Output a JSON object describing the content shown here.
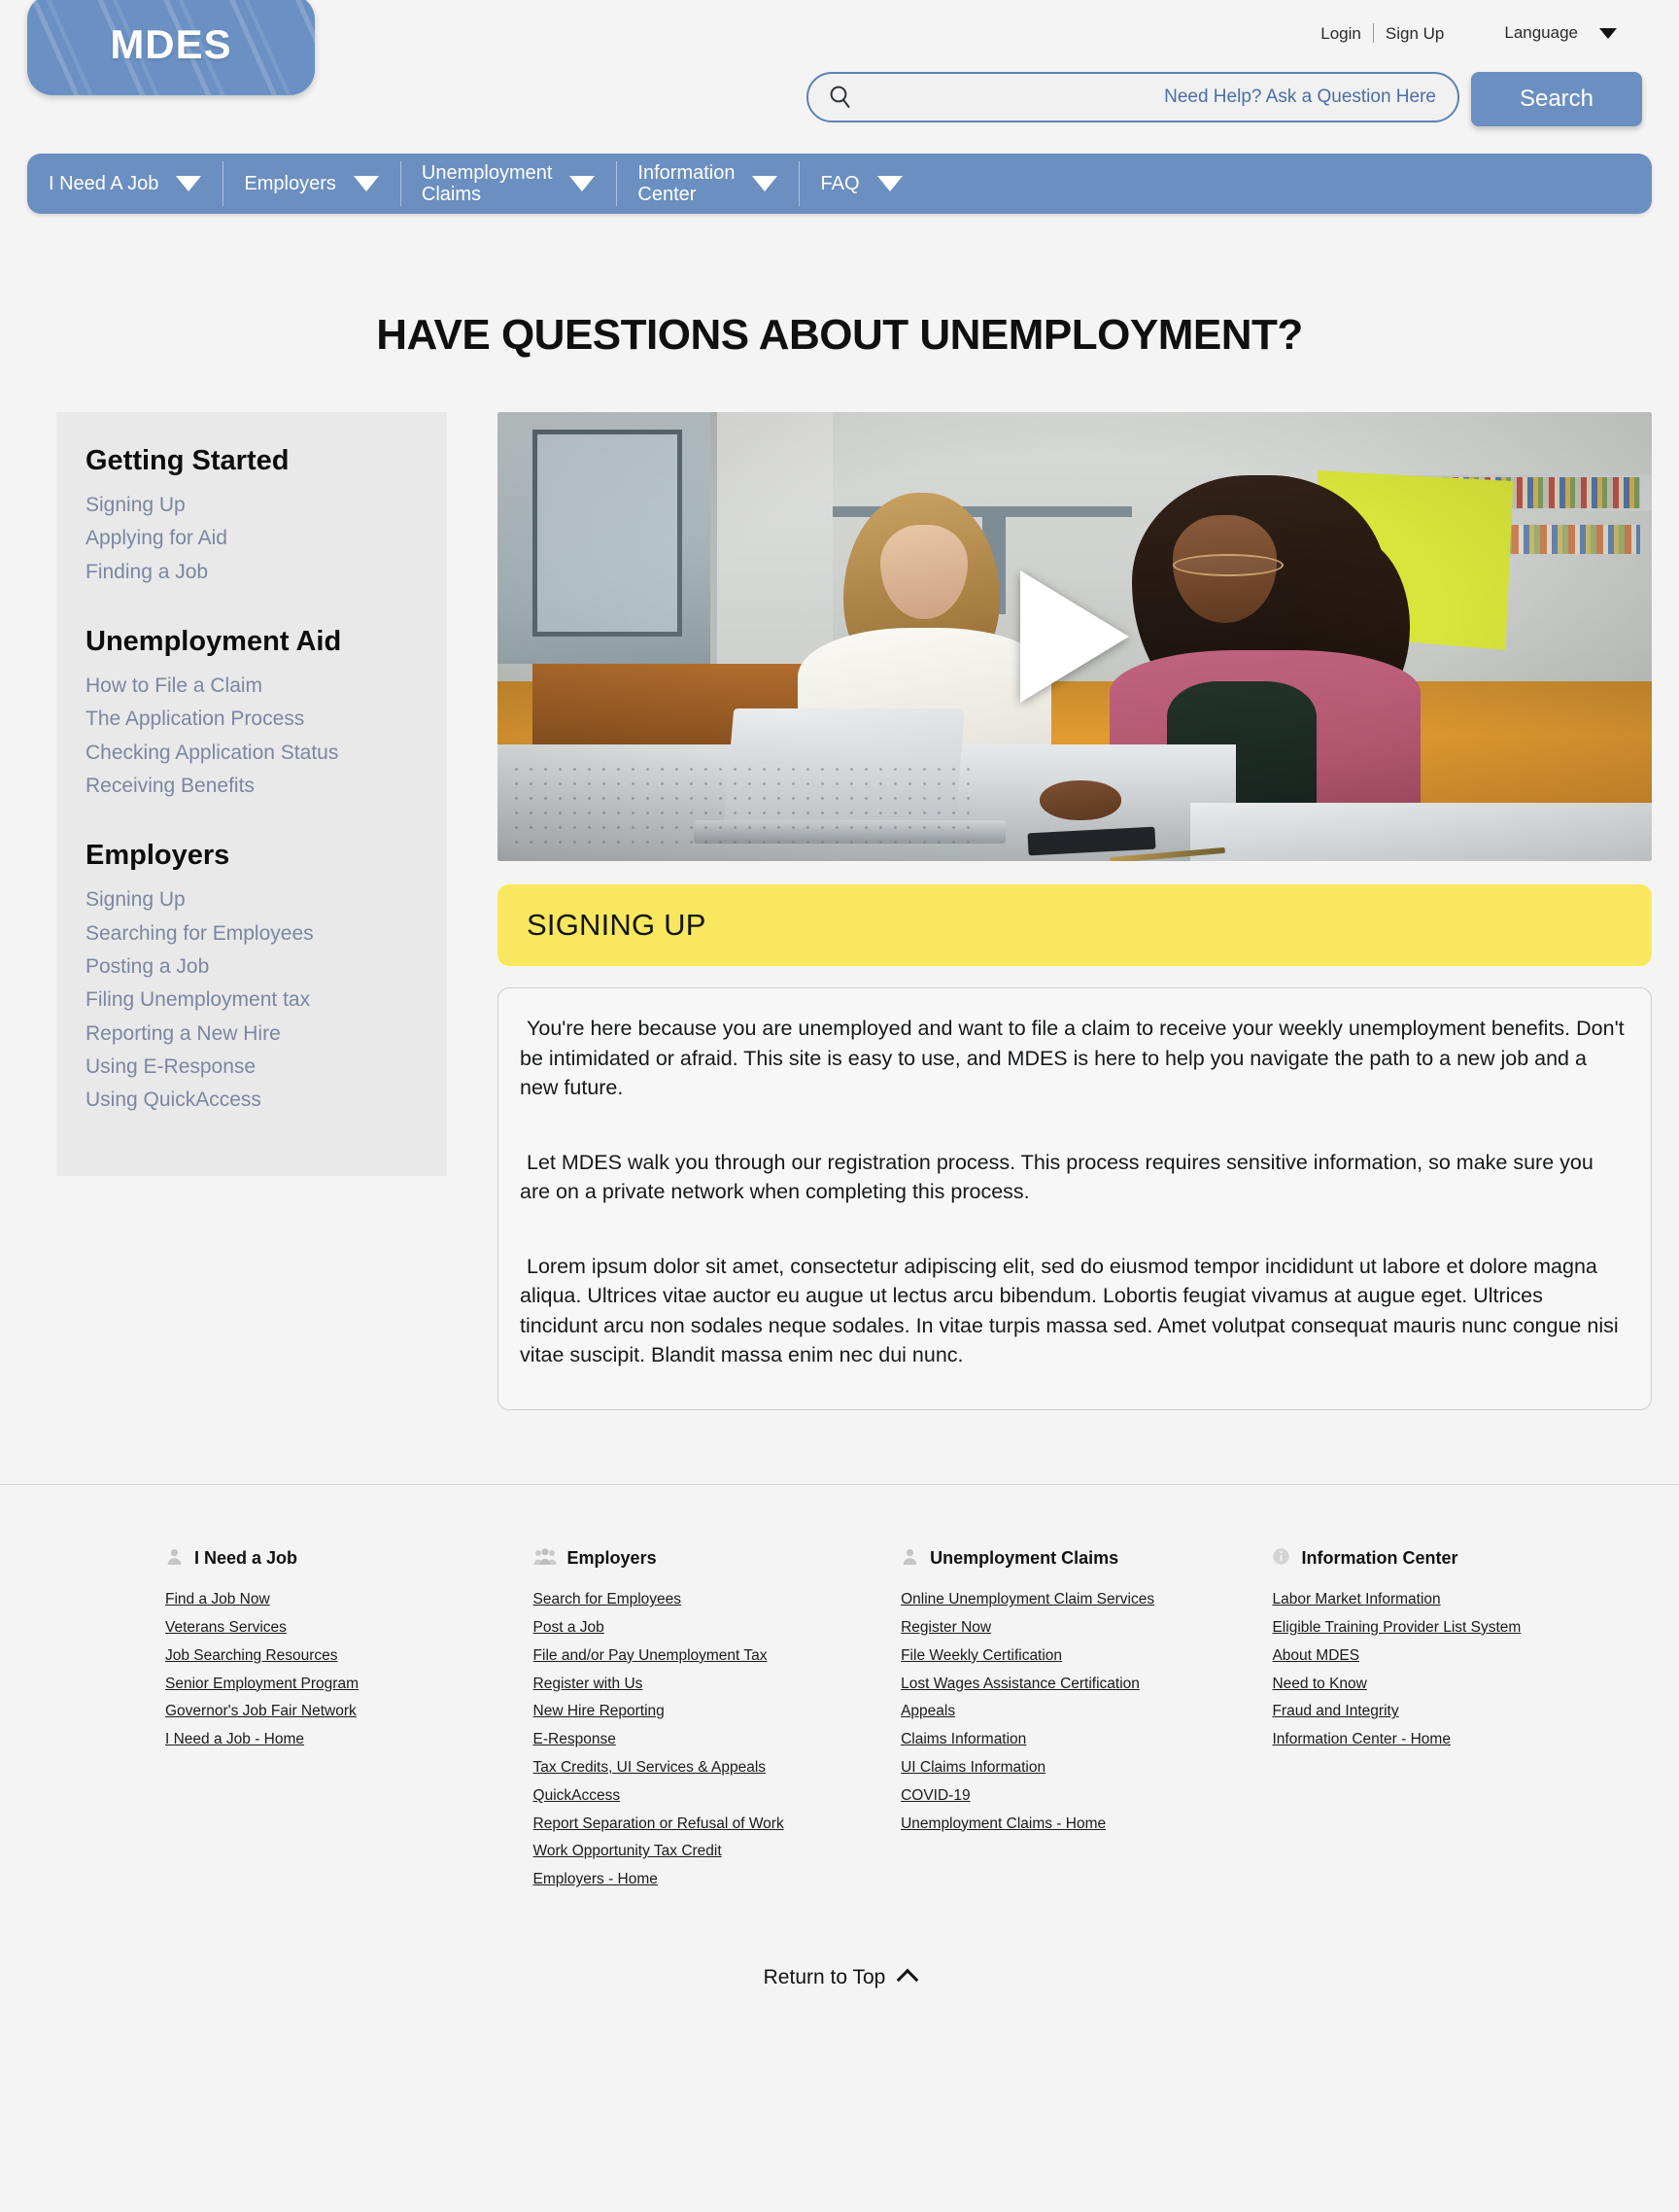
{
  "utility": {
    "login": "Login",
    "signup": "Sign Up",
    "language": "Language"
  },
  "brand": {
    "logo_text": "MDES"
  },
  "search": {
    "placeholder": "Need Help? Ask a Question Here",
    "value": "",
    "button_label": "Search"
  },
  "nav": {
    "items": [
      {
        "label": "I Need A Job"
      },
      {
        "label": "Employers"
      },
      {
        "label": "Unemployment\nClaims"
      },
      {
        "label": "Information\nCenter"
      },
      {
        "label": "FAQ"
      }
    ]
  },
  "page": {
    "title": "HAVE QUESTIONS ABOUT UNEMPLOYMENT?"
  },
  "sidebar": {
    "groups": [
      {
        "heading": "Getting Started",
        "links": [
          "Signing Up",
          "Applying for Aid",
          "Finding a Job"
        ]
      },
      {
        "heading": "Unemployment Aid",
        "links": [
          "How to File a Claim",
          "The Application Process",
          "Checking Application Status",
          "Receiving Benefits"
        ]
      },
      {
        "heading": "Employers",
        "links": [
          "Signing Up",
          "Searching for Employees",
          "Posting a Job",
          "Filing Unemployment tax",
          "Reporting a New Hire",
          "Using E-Response",
          "Using QuickAccess"
        ]
      }
    ]
  },
  "video": {
    "play_label": "Play video"
  },
  "banner": {
    "title": "SIGNING UP"
  },
  "article": {
    "paragraphs": [
      "You're here because you are unemployed and want to file a claim to receive your weekly unemployment benefits. Don't be intimidated or afraid. This site is easy to use, and MDES is here to help you navigate the path to a new job and a new future.",
      "Let MDES walk you through our registration process. This process requires sensitive information, so make sure you are on a private network when completing this process.",
      "Lorem ipsum dolor sit amet, consectetur adipiscing elit, sed do eiusmod tempor incididunt ut labore et dolore magna aliqua. Ultrices vitae auctor eu augue ut lectus arcu bibendum. Lobortis feugiat vivamus at augue eget. Ultrices tincidunt arcu non sodales neque sodales. In vitae turpis massa sed. Amet volutpat consequat mauris nunc congue nisi vitae suscipit. Blandit massa enim nec dui nunc."
    ]
  },
  "footer": {
    "columns": [
      {
        "icon": "person-icon",
        "heading": "I Need a Job",
        "links": [
          "Find a Job Now",
          "Veterans Services",
          "Job Searching Resources",
          "Senior Employment Program",
          "Governor's Job Fair Network",
          "I Need a Job - Home"
        ]
      },
      {
        "icon": "people-group-icon",
        "heading": "Employers",
        "links": [
          "Search for Employees",
          "Post a Job",
          "File and/or Pay Unemployment Tax",
          "Register with Us",
          "New Hire Reporting",
          "E-Response",
          "Tax Credits, UI Services & Appeals",
          "QuickAccess",
          "Report Separation or Refusal of Work",
          "Work Opportunity  Tax Credit",
          "Employers - Home"
        ]
      },
      {
        "icon": "person-icon",
        "heading": "Unemployment Claims",
        "links": [
          "Online Unemployment Claim Services",
          "Register Now",
          "File Weekly Certification",
          "Lost Wages Assistance Certification",
          "Appeals",
          "Claims Information",
          "UI Claims Information",
          "COVID-19",
          "Unemployment Claims - Home"
        ]
      },
      {
        "icon": "info-circle-icon",
        "heading": "Information Center",
        "links": [
          "Labor Market Information",
          "Eligible Training Provider List System",
          "About MDES",
          "Need to Know",
          "Fraud and Integrity",
          "Information Center - Home"
        ]
      }
    ]
  },
  "return_top": {
    "label": "Return to Top"
  },
  "colors": {
    "brand_blue": "#6b8fc0",
    "banner_yellow": "#f9e85f",
    "sidebar_bg": "#e9e9e9",
    "sidebar_link": "#7b86a2",
    "page_bg": "#f4f4f4"
  }
}
